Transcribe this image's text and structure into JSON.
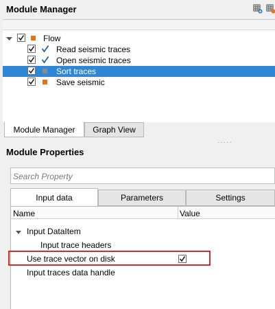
{
  "module_manager": {
    "title": "Module Manager",
    "icons": [
      "grid-add-icon",
      "grid-settings-icon"
    ],
    "tree": [
      {
        "label": "Flow",
        "checked": true,
        "marker": "orange-square",
        "expanded": true
      },
      {
        "label": "Read seismic traces",
        "checked": true,
        "marker": "blue-check"
      },
      {
        "label": "Open seismic traces",
        "checked": true,
        "marker": "blue-check"
      },
      {
        "label": "Sort traces",
        "checked": true,
        "marker": "gray-square",
        "selected": true
      },
      {
        "label": "Save seismic",
        "checked": true,
        "marker": "orange-square"
      }
    ],
    "tabs": [
      "Module Manager",
      "Graph View"
    ],
    "active_tab": "Module Manager"
  },
  "module_properties": {
    "title": "Module Properties",
    "search_placeholder": "Search Property",
    "tabs": [
      "Input data",
      "Parameters",
      "Settings"
    ],
    "active_tab": "Input data",
    "columns": [
      "Name",
      "Value"
    ],
    "rows": [
      {
        "name": "Input DataItem",
        "expandable": true
      },
      {
        "name": "Input trace headers"
      },
      {
        "name": "Use trace vector on disk",
        "value_checked": true,
        "highlighted": true
      },
      {
        "name": "Input traces data handle"
      }
    ]
  },
  "colors": {
    "selection": "#2f86d4",
    "orange_marker": "#e8711c",
    "check_blue": "#1f5fa8",
    "highlight_border": "#d62b2b"
  }
}
